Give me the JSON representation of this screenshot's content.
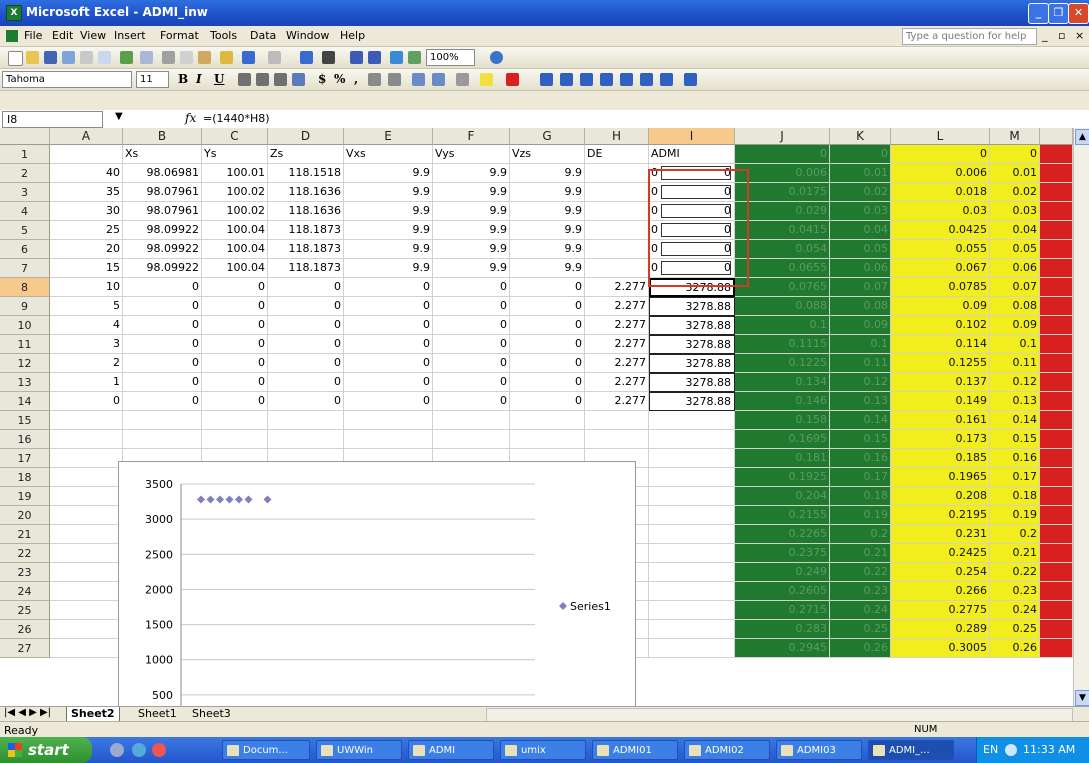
{
  "window": {
    "title": "Microsoft Excel - ADMI_inw",
    "app_icon": "X"
  },
  "menu": [
    "File",
    "Edit",
    "View",
    "Insert",
    "Format",
    "Tools",
    "Data",
    "Window",
    "Help"
  ],
  "help_placeholder": "Type a question for help",
  "toolbar": {
    "zoom": "100%",
    "font": "Tahoma",
    "size": "11",
    "bold": "B",
    "italic": "I",
    "underline": "U",
    "currency": "$",
    "percent": "%",
    "comma": ","
  },
  "formula_bar": {
    "name_box": "I8",
    "fx": "fx",
    "formula": "=(1440*H8)"
  },
  "columns": [
    "A",
    "B",
    "C",
    "D",
    "E",
    "F",
    "G",
    "H",
    "I",
    "J",
    "K",
    "L",
    "M"
  ],
  "rows": [
    "1",
    "2",
    "3",
    "4",
    "5",
    "6",
    "7",
    "8",
    "9",
    "10",
    "11",
    "12",
    "13",
    "14",
    "15",
    "16",
    "17",
    "18",
    "19",
    "20",
    "21",
    "22",
    "23",
    "24",
    "25",
    "26",
    "27"
  ],
  "headers": [
    "",
    "Xs",
    "Ys",
    "Zs",
    "Vxs",
    "Vys",
    "Vzs",
    "DE",
    "ADMI"
  ],
  "table_rows": [
    [
      "40",
      "98.06981",
      "100.01",
      "118.1518",
      "9.9",
      "9.9",
      "9.9",
      "",
      "0",
      "0"
    ],
    [
      "35",
      "98.07961",
      "100.02",
      "118.1636",
      "9.9",
      "9.9",
      "9.9",
      "",
      "0",
      "0"
    ],
    [
      "30",
      "98.07961",
      "100.02",
      "118.1636",
      "9.9",
      "9.9",
      "9.9",
      "",
      "0",
      "0"
    ],
    [
      "25",
      "98.09922",
      "100.04",
      "118.1873",
      "9.9",
      "9.9",
      "9.9",
      "",
      "0",
      "0"
    ],
    [
      "20",
      "98.09922",
      "100.04",
      "118.1873",
      "9.9",
      "9.9",
      "9.9",
      "",
      "0",
      "0"
    ],
    [
      "15",
      "98.09922",
      "100.04",
      "118.1873",
      "9.9",
      "9.9",
      "9.9",
      "",
      "0",
      "0"
    ],
    [
      "10",
      "0",
      "0",
      "0",
      "0",
      "0",
      "0",
      "2.277",
      "",
      "3278.88"
    ],
    [
      "5",
      "0",
      "0",
      "0",
      "0",
      "0",
      "0",
      "2.277",
      "",
      "3278.88"
    ],
    [
      "4",
      "0",
      "0",
      "0",
      "0",
      "0",
      "0",
      "2.277",
      "",
      "3278.88"
    ],
    [
      "3",
      "0",
      "0",
      "0",
      "0",
      "0",
      "0",
      "2.277",
      "",
      "3278.88"
    ],
    [
      "2",
      "0",
      "0",
      "0",
      "0",
      "0",
      "0",
      "2.277",
      "",
      "3278.88"
    ],
    [
      "1",
      "0",
      "0",
      "0",
      "0",
      "0",
      "0",
      "2.277",
      "",
      "3278.88"
    ],
    [
      "0",
      "0",
      "0",
      "0",
      "0",
      "0",
      "0",
      "2.277",
      "",
      "3278.88"
    ]
  ],
  "side_columns": {
    "J": [
      "0",
      "0.006",
      "0.0175",
      "0.029",
      "0.0415",
      "0.054",
      "0.0655",
      "0.0765",
      "0.088",
      "0.1",
      "0.1115",
      "0.1225",
      "0.134",
      "0.146",
      "0.158",
      "0.1695",
      "0.181",
      "0.1925",
      "0.204",
      "0.2155",
      "0.2265",
      "0.2375",
      "0.249",
      "0.2605",
      "0.2715",
      "0.283",
      "0.2945"
    ],
    "K": [
      "0",
      "0.01",
      "0.02",
      "0.03",
      "0.04",
      "0.05",
      "0.06",
      "0.07",
      "0.08",
      "0.09",
      "0.1",
      "0.11",
      "0.12",
      "0.13",
      "0.14",
      "0.15",
      "0.16",
      "0.17",
      "0.18",
      "0.19",
      "0.2",
      "0.21",
      "0.22",
      "0.23",
      "0.24",
      "0.25",
      "0.26"
    ],
    "L": [
      "0",
      "0.006",
      "0.018",
      "0.03",
      "0.0425",
      "0.055",
      "0.067",
      "0.0785",
      "0.09",
      "0.102",
      "0.114",
      "0.1255",
      "0.137",
      "0.149",
      "0.161",
      "0.173",
      "0.185",
      "0.1965",
      "0.208",
      "0.2195",
      "0.231",
      "0.2425",
      "0.254",
      "0.266",
      "0.2775",
      "0.289",
      "0.3005"
    ],
    "M": [
      "0",
      "0.01",
      "0.02",
      "0.03",
      "0.04",
      "0.05",
      "0.06",
      "0.07",
      "0.08",
      "0.09",
      "0.1",
      "0.11",
      "0.12",
      "0.13",
      "0.14",
      "0.15",
      "0.16",
      "0.17",
      "0.18",
      "0.19",
      "0.2",
      "0.21",
      "0.22",
      "0.23",
      "0.24",
      "0.25",
      "0.26"
    ]
  },
  "chart_data": {
    "type": "scatter",
    "series": [
      {
        "name": "Series1",
        "x": [
          1,
          2,
          3,
          4,
          5,
          6,
          8
        ],
        "y": [
          3278.88,
          3278.88,
          3278.88,
          3278.88,
          3278.88,
          3278.88,
          3278.88
        ]
      }
    ],
    "yticks": [
      "3500",
      "3000",
      "2500",
      "2000",
      "1500",
      "1000",
      "500"
    ],
    "ylim": [
      0,
      3500
    ],
    "grid": true,
    "legend": "right",
    "marker_color": "#8080c0"
  },
  "tabs": [
    "Sheet2",
    "Sheet1",
    "Sheet3"
  ],
  "status": {
    "left": "Ready",
    "num": "NUM"
  },
  "taskbar": {
    "start": "start",
    "items": [
      "Docum...",
      "UWWin",
      "ADMI",
      "umix",
      "ADMI01",
      "ADMI02",
      "ADMI03",
      "ADMI_..."
    ],
    "lang": "EN",
    "clock": "11:33 AM"
  },
  "colors": {
    "green": "#1f7a2f",
    "yellow": "#f2ee1e",
    "red": "#d82020",
    "highlight": "#d23a2a"
  }
}
